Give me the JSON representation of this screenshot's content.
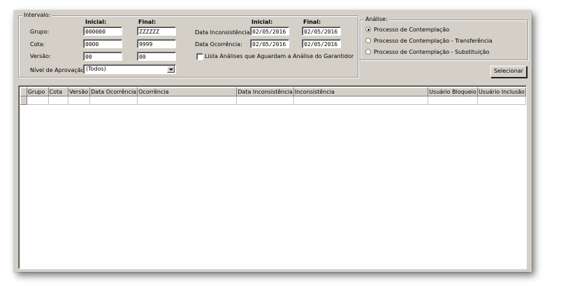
{
  "intervalo": {
    "title": "Intervalo:",
    "col_inicial": "Inicial:",
    "col_final": "Final:",
    "rows": [
      {
        "label": "Grupo:",
        "inicial": "000000",
        "final": "ZZZZZZ"
      },
      {
        "label": "Cota:",
        "inicial": "0000",
        "final": "9999"
      },
      {
        "label": "Versão:",
        "inicial": "00",
        "final": "00"
      }
    ],
    "nivel_label": "Nível de Aprovação:",
    "nivel_value": "(Todos)"
  },
  "datas": {
    "col_inicial": "Inicial:",
    "col_final": "Final:",
    "rows": [
      {
        "label": "Data Inconsistência:",
        "inicial": "02/05/2016",
        "final": "02/05/2016"
      },
      {
        "label": "Data  Ocorrência:",
        "inicial": "02/05/2016",
        "final": "02/05/2016"
      }
    ],
    "checkbox_label": "Lista Análises que Aguardam a Análise do Garantidor",
    "checkbox_checked": false
  },
  "analise": {
    "title": "Análise:",
    "options": [
      {
        "label": "Processo de Contemplação",
        "selected": true
      },
      {
        "label": "Processo de Contemplação - Transferência",
        "selected": false
      },
      {
        "label": "Processo de Contemplação - Substituição",
        "selected": false
      }
    ]
  },
  "selecionar_label": "Selecionar",
  "grid": {
    "columns": [
      "Grupo",
      "Cota",
      "Versão",
      "Data Ocorrência",
      "Ocorrência",
      "Data Inconsistência",
      "Inconsistência",
      "Usuário Bloqueio",
      "Usuário Inclusão"
    ]
  }
}
